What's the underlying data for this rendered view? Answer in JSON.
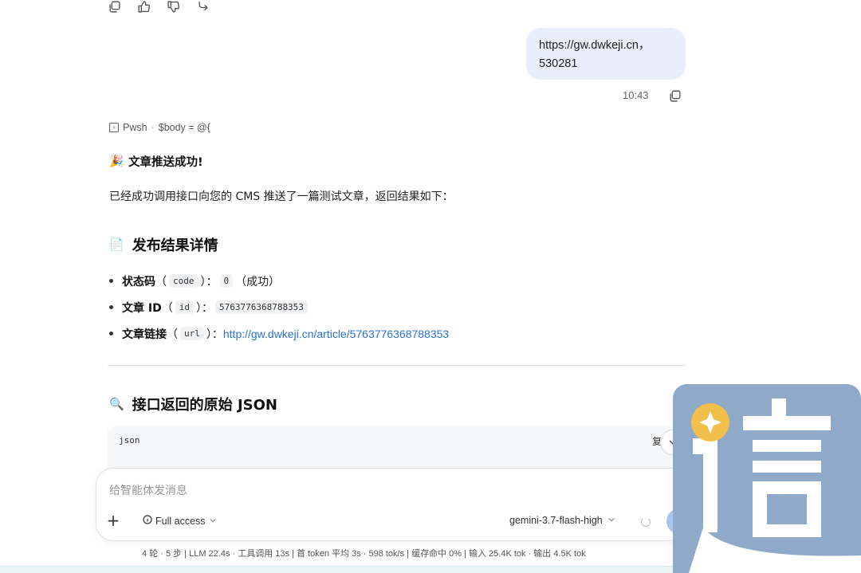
{
  "message_actions": [
    "copy-icon",
    "thumbs-up-icon",
    "thumbs-down-icon",
    "fork-icon"
  ],
  "user_message": {
    "text_line1": "https://gw.dwkeji.cn，",
    "text_line2": "530281",
    "time": "10:43"
  },
  "tool_call": {
    "name": "Pwsh",
    "separator": "·",
    "snippet": "$body = @{"
  },
  "assistant": {
    "success_emoji": "🎉",
    "success_title": "文章推送成功!",
    "intro": "已经成功调用接口向您的 CMS 推送了一篇测试文章，返回结果如下：",
    "result_heading_emoji": "📄",
    "result_heading": "发布结果详情",
    "items": [
      {
        "label": "状态码",
        "paren_open": "（",
        "key": "code",
        "paren_close": "）：",
        "value": "0",
        "note": "（成功）"
      },
      {
        "label": "文章 ID",
        "paren_open": "（",
        "key": "id",
        "paren_close": "）：",
        "value": "5763776368788353",
        "note": ""
      },
      {
        "label": "文章链接",
        "paren_open": "（",
        "key": "url",
        "paren_close": "）：",
        "value": "http://gw.dwkeji.cn/article/5763776368788353",
        "note": ""
      }
    ],
    "json_heading_emoji": "🔍",
    "json_heading": "接口返回的原始 JSON",
    "code_lang": "json",
    "code_copy": "复"
  },
  "composer": {
    "placeholder": "给智能体发消息",
    "access_label": "Full access",
    "model_label": "gemini-3.7-flash-high"
  },
  "stats": "4 轮 · 5 步  |  LLM 22.4s · 工具调用 13s  |  首 token 平均 3s · 598 tok/s  |  缓存命中 0%  |  输入 25.4K tok · 输出 4.5K tok",
  "colors": {
    "user_bubble": "#e8eefb",
    "link": "#2f6fd0",
    "send_button": "#a8c4ee",
    "logo_bg": "#8fa9c8",
    "logo_badge": "#f2c04a"
  }
}
